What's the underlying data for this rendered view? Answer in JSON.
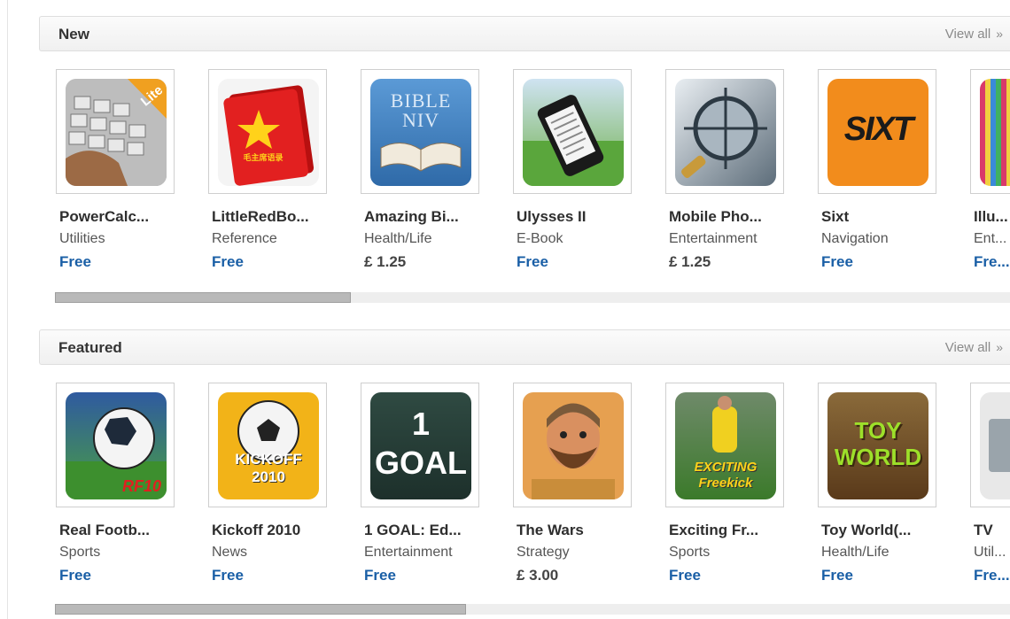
{
  "sections": [
    {
      "title": "New",
      "view_all": "View all",
      "scroll_fraction": 0.31,
      "apps": [
        {
          "name": "PowerCalc...",
          "category": "Utilities",
          "price": "Free",
          "icon": "calculator-icon"
        },
        {
          "name": "LittleRedBo...",
          "category": "Reference",
          "price": "Free",
          "icon": "red-book-icon",
          "icon_text": "毛主席语录"
        },
        {
          "name": "Amazing Bi...",
          "category": "Health/Life",
          "price": "£ 1.25",
          "icon": "bible-icon",
          "icon_text": "BIBLE NIV"
        },
        {
          "name": "Ulysses II",
          "category": "E-Book",
          "price": "Free",
          "icon": "ebook-phone-icon"
        },
        {
          "name": "Mobile Pho...",
          "category": "Entertainment",
          "price": "£ 1.25",
          "icon": "phone-scanner-icon"
        },
        {
          "name": "Sixt",
          "category": "Navigation",
          "price": "Free",
          "icon": "sixt-logo-icon",
          "icon_text": "SIXT"
        },
        {
          "name": "Illu...",
          "category": "Ent...",
          "price": "Fre...",
          "icon": "illusion-icon"
        }
      ]
    },
    {
      "title": "Featured",
      "view_all": "View all",
      "scroll_fraction": 0.43,
      "apps": [
        {
          "name": "Real Footb...",
          "category": "Sports",
          "price": "Free",
          "icon": "football-icon",
          "icon_text": "RF10"
        },
        {
          "name": "Kickoff 2010",
          "category": "News",
          "price": "Free",
          "icon": "kickoff-ball-icon",
          "icon_text": "KICKOFF 2010"
        },
        {
          "name": "1 GOAL: Ed...",
          "category": "Entertainment",
          "price": "Free",
          "icon": "one-goal-icon",
          "icon_text": "1 GOAL"
        },
        {
          "name": "The Wars",
          "category": "Strategy",
          "price": "£ 3.00",
          "icon": "caveman-icon"
        },
        {
          "name": "Exciting Fr...",
          "category": "Sports",
          "price": "Free",
          "icon": "freekick-icon",
          "icon_text": "EXCITING Freekick"
        },
        {
          "name": "Toy World(...",
          "category": "Health/Life",
          "price": "Free",
          "icon": "toy-world-icon",
          "icon_text": "TOY WORLD"
        },
        {
          "name": "TV",
          "category": "Util...",
          "price": "Fre...",
          "icon": "tv-icon"
        }
      ]
    }
  ],
  "colors": {
    "price_free": "#1a5fa6",
    "price_paid": "#444444",
    "header_bg": "#f2f2f2"
  }
}
